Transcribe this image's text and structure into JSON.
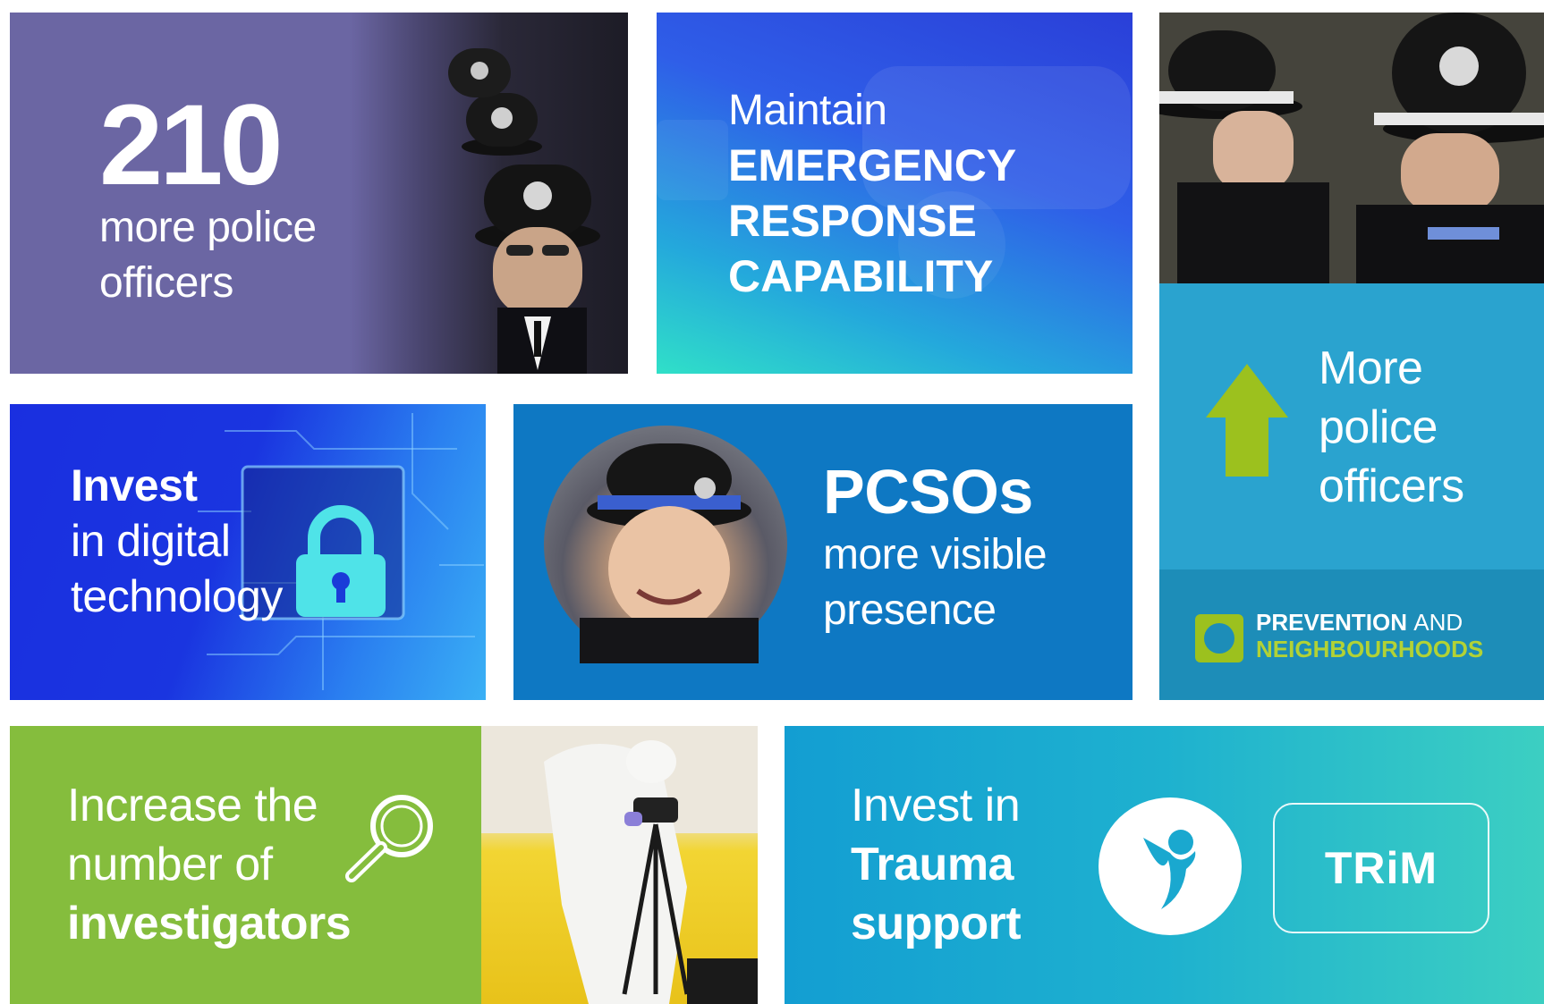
{
  "tiles": {
    "officers": {
      "number": "210",
      "line1": "more police",
      "line2": "officers"
    },
    "emergency": {
      "line1": "Maintain",
      "line2": "EMERGENCY",
      "line3": "RESPONSE",
      "line4": "CAPABILITY"
    },
    "more_officers": {
      "line1": "More",
      "line2": "police",
      "line3": "officers"
    },
    "prevention": {
      "word1": "PREVENTION",
      "word2": "AND",
      "word3": "NEIGHBOURHOODS"
    },
    "digital": {
      "line1": "Invest",
      "line2": "in digital",
      "line3": "technology"
    },
    "pcsos": {
      "heading": "PCSOs",
      "line1": "more visible",
      "line2": "presence"
    },
    "investigators": {
      "line1": "Increase the",
      "line2": "number of",
      "line3": "investigators"
    },
    "trauma": {
      "line1": "Invest in",
      "line2": "Trauma",
      "line3": "support",
      "badge": "TRiM"
    }
  },
  "icons": [
    "up-arrow-icon",
    "padlock-icon",
    "magnifier-icon",
    "person-icon",
    "prevention-logo-icon"
  ],
  "colors": {
    "purple": "#6b66a3",
    "lime_arrow": "#9cc11e",
    "pcso_blue": "#0e78c3",
    "green_tile": "#85bd3d",
    "teal": "#3ccfc2"
  }
}
